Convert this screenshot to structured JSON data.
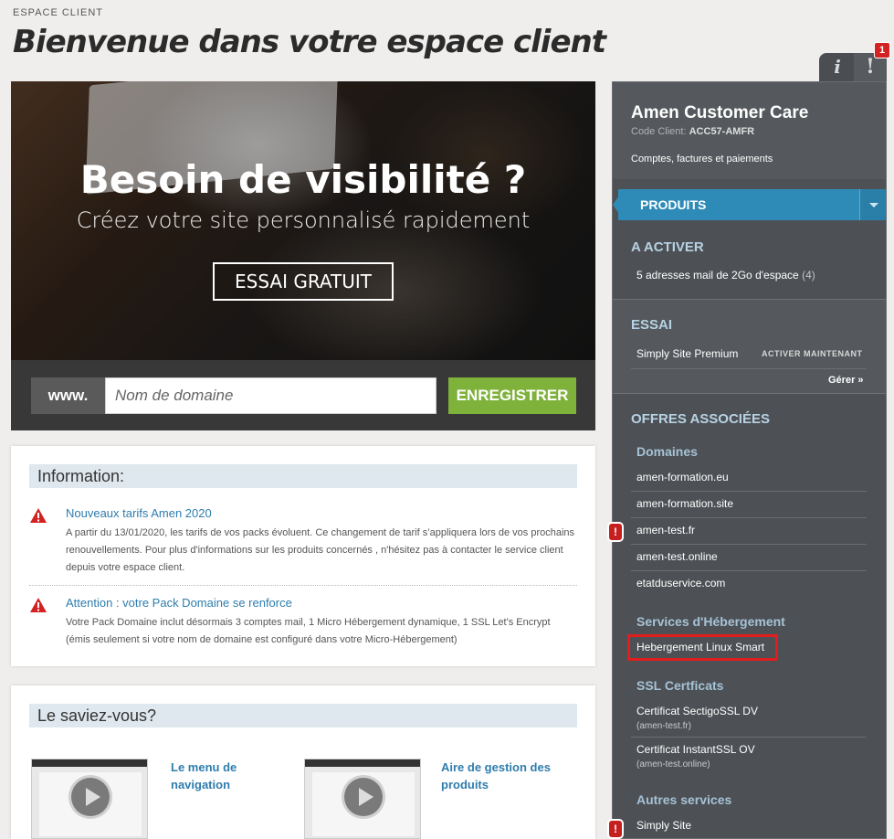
{
  "header": {
    "breadcrumb": "ESPACE CLIENT",
    "title": "Bienvenue dans votre espace client"
  },
  "tabs": {
    "info_label": "i",
    "alert_label": "!",
    "alert_count": "1"
  },
  "hero": {
    "headline": "Besoin de visibilité ?",
    "subheadline": "Créez votre site personnalisé rapidement",
    "cta_label": "ESSAI GRATUIT"
  },
  "domain_search": {
    "prefix": "www.",
    "placeholder": "Nom de domaine",
    "button_label": "ENREGISTRER"
  },
  "information": {
    "title": "Information:",
    "items": [
      {
        "title": "Nouveaux tarifs Amen 2020",
        "body": "A partir du 13/01/2020, les tarifs de vos packs évoluent. Ce changement de tarif s’appliquera lors de vos prochains renouvellements. Pour plus d'informations sur les produits concernés , n'hésitez pas à contacter le service client depuis votre espace client."
      },
      {
        "title": "Attention : votre Pack Domaine se renforce",
        "body": "Votre Pack Domaine inclut désormais 3 comptes mail, 1 Micro Hébergement dynamique, 1 SSL Let's Encrypt (émis seulement si votre nom de domaine est configuré dans votre Micro-Hébergement)"
      }
    ]
  },
  "tips": {
    "title": "Le saviez-vous?",
    "items": [
      {
        "label": "Le menu de navigation"
      },
      {
        "label": "Aire de gestion des produits"
      }
    ]
  },
  "sidebar": {
    "account_name": "Amen Customer Care",
    "code_label": "Code Client:",
    "code_value": "ACC57-AMFR",
    "account_link": "Comptes, factures et paiements",
    "products_label": "PRODUITS",
    "to_activate": {
      "heading": "A ACTIVER",
      "item_label": "5 adresses mail de 2Go d'espace",
      "item_count": "(4)"
    },
    "trial": {
      "heading": "ESSAI",
      "item_label": "Simply Site Premium",
      "activate_label": "ACTIVER MAINTENANT",
      "manage_label": "Gérer »"
    },
    "offers": {
      "heading": "OFFRES ASSOCIÉES",
      "domains_heading": "Domaines",
      "domains": [
        "amen-formation.eu",
        "amen-formation.site",
        "amen-test.fr",
        "amen-test.online",
        "etatduservice.com"
      ],
      "hosting_heading": "Services d'Hébergement",
      "hosting": [
        "Hebergement Linux Smart"
      ],
      "ssl_heading": "SSL Certficats",
      "ssl": [
        {
          "name": "Certificat SectigoSSL DV",
          "domain": "(amen-test.fr)"
        },
        {
          "name": "Certificat InstantSSL OV",
          "domain": "(amen-test.online)"
        }
      ],
      "other_heading": "Autres services",
      "other": [
        "Simply Site"
      ]
    },
    "alert_marker": "!"
  }
}
